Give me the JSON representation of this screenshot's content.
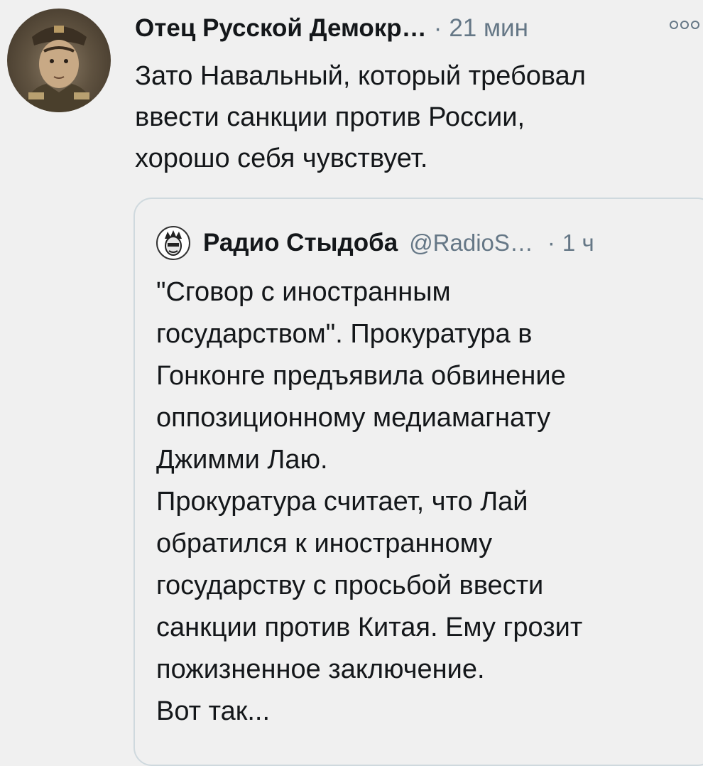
{
  "tweet": {
    "author_name": "Отец Русской Демокр…",
    "separator": "·",
    "time": "21 мин",
    "more_icon": "more-horizontal-icon",
    "text": "Зато Навальный, который требовал\nввести санкции против России,\nхорошо себя чувствует."
  },
  "quoted_tweet": {
    "author_name": "Радио Стыдоба",
    "handle": "@RadioS…",
    "separator": "·",
    "time": "1 ч",
    "text": "\"Сговор с иностранным\nгосударством\". Прокуратура в\nГонконге предъявила обвинение\nоппозиционному медиамагнату\nДжимми Лаю.\nПрокуратура считает, что Лай\nобратился к иностранному\nгосударству с просьбой ввести\nсанкции против Китая. Ему грозит\nпожизненное заключение.\nВот так..."
  }
}
